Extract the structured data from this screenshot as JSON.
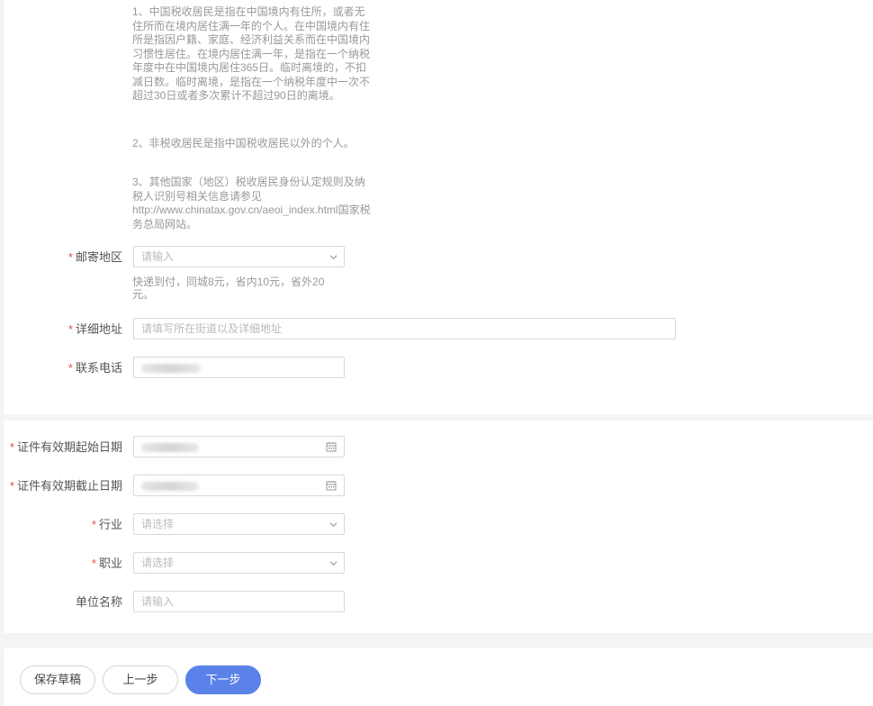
{
  "notes": {
    "p1": "1、中国税收居民是指在中国境内有住所，或者无住所而在境内居住满一年的个人。在中国境内有住所是指因户籍、家庭、经济利益关系而在中国境内习惯性居住。在境内居住满一年，是指在一个纳税年度中在中国境内居住365日。临时离境的，不扣减日数。临时离境，是指在一个纳税年度中一次不超过30日或者多次累计不超过90日的离境。",
    "p2": "2、非税收居民是指中国税收居民以外的个人。",
    "p3": "3、其他国家（地区）税收居民身份认定规则及纳税人识别号相关信息请参见http://www.chinatax.gov.cn/aeoi_index.html国家税务总局网站。"
  },
  "form": {
    "required_mark": "*",
    "mail_region": {
      "label": "邮寄地区",
      "placeholder": "请输入",
      "hint": "快递到付，同城8元，省内10元，省外20元。"
    },
    "address": {
      "label": "详细地址",
      "placeholder": "请填写所在街道以及详细地址"
    },
    "phone": {
      "label": "联系电话"
    },
    "id_start": {
      "label": "证件有效期起始日期"
    },
    "id_end": {
      "label": "证件有效期截止日期"
    },
    "industry": {
      "label": "行业",
      "placeholder": "请选择"
    },
    "occupation": {
      "label": "职业",
      "placeholder": "请选择"
    },
    "employer": {
      "label": "单位名称",
      "placeholder": "请输入"
    }
  },
  "actions": {
    "save_draft": "保存草稿",
    "prev": "上一步",
    "next": "下一步"
  },
  "icons": {
    "dropdown": "chevron-down-icon",
    "date": "calendar-icon"
  },
  "colors": {
    "required": "#e94b4b",
    "primary": "#5a82e8"
  }
}
